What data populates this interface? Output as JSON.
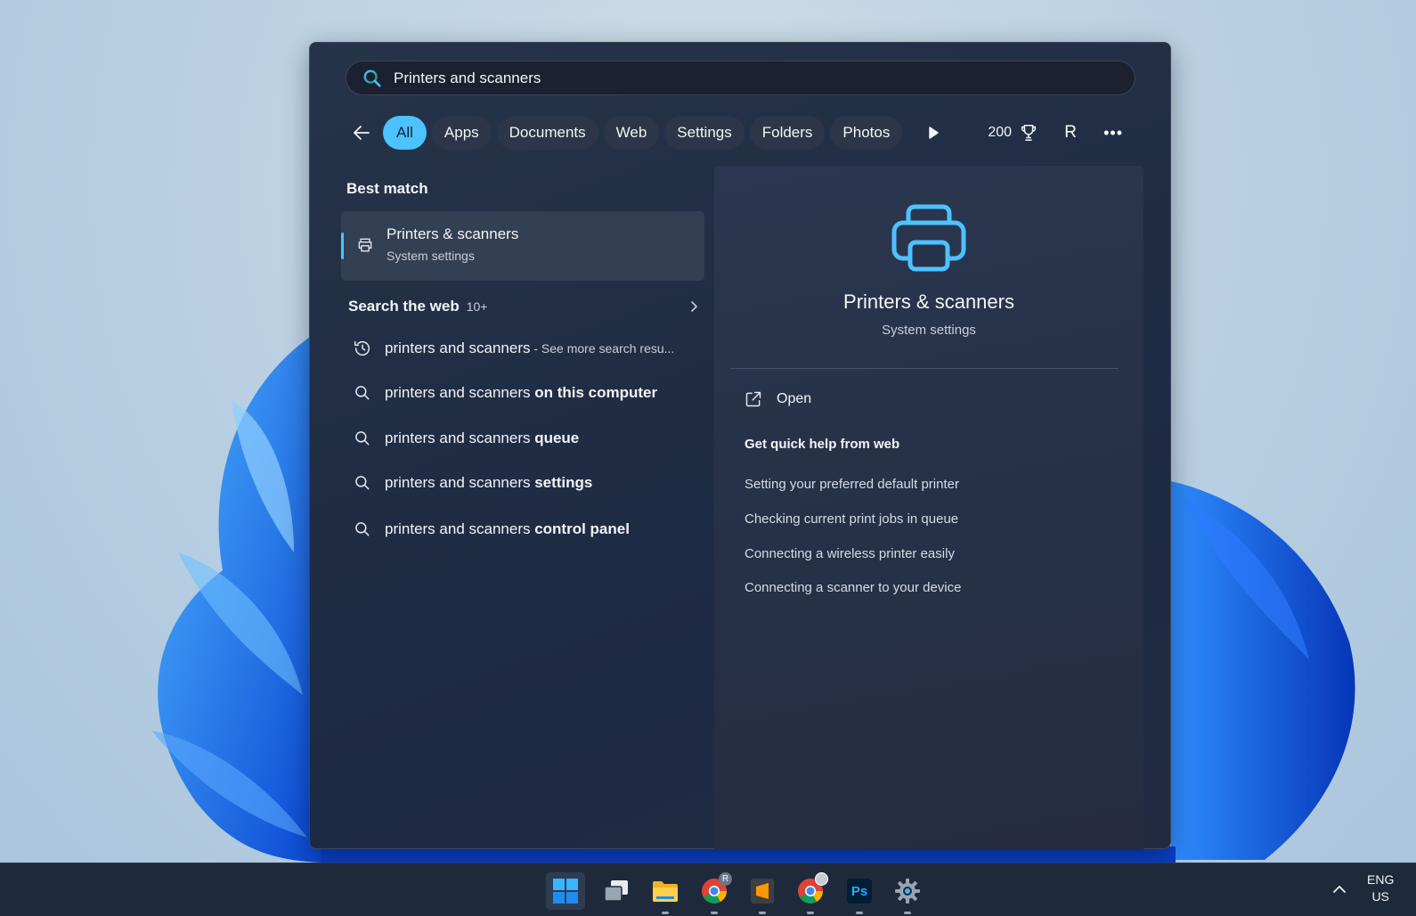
{
  "search": {
    "value": "Printers and scanners"
  },
  "filters": {
    "chips": [
      "All",
      "Apps",
      "Documents",
      "Web",
      "Settings",
      "Folders",
      "Photos"
    ],
    "active": "All",
    "points": "200",
    "avatar_letter": "R",
    "more": "•••"
  },
  "best_match": {
    "heading": "Best match",
    "title": "Printers & scanners",
    "subtitle": "System settings"
  },
  "web": {
    "heading": "Search the web",
    "count": "10+",
    "items": [
      {
        "icon": "history-icon",
        "normal": "printers and scanners",
        "bold": "",
        "suffix": " - See more search resu..."
      },
      {
        "icon": "search-icon",
        "normal": "printers and scanners ",
        "bold": "on this computer",
        "suffix": ""
      },
      {
        "icon": "search-icon",
        "normal": "printers and scanners ",
        "bold": "queue",
        "suffix": ""
      },
      {
        "icon": "search-icon",
        "normal": "printers and scanners ",
        "bold": "settings",
        "suffix": ""
      },
      {
        "icon": "search-icon",
        "normal": "printers and scanners ",
        "bold": "control panel",
        "suffix": ""
      }
    ]
  },
  "detail": {
    "title": "Printers & scanners",
    "subtitle": "System settings",
    "open_label": "Open",
    "help_title": "Get quick help from web",
    "help_links": [
      "Setting your preferred default printer",
      "Checking current print jobs in queue",
      "Connecting a wireless printer easily",
      "Connecting a scanner to your device"
    ]
  },
  "taskbar": {
    "apps": [
      "windows-start",
      "task-view",
      "file-explorer",
      "chrome-profile-r",
      "sublime-text",
      "chrome",
      "photoshop",
      "settings"
    ],
    "photoshop_label": "Ps",
    "chrome_badge": "R",
    "lang_line1": "ENG",
    "lang_line2": "US"
  },
  "colors": {
    "accent": "#4cc2ff",
    "panel": "#1f2c44",
    "taskbar": "#1e2a3c"
  }
}
